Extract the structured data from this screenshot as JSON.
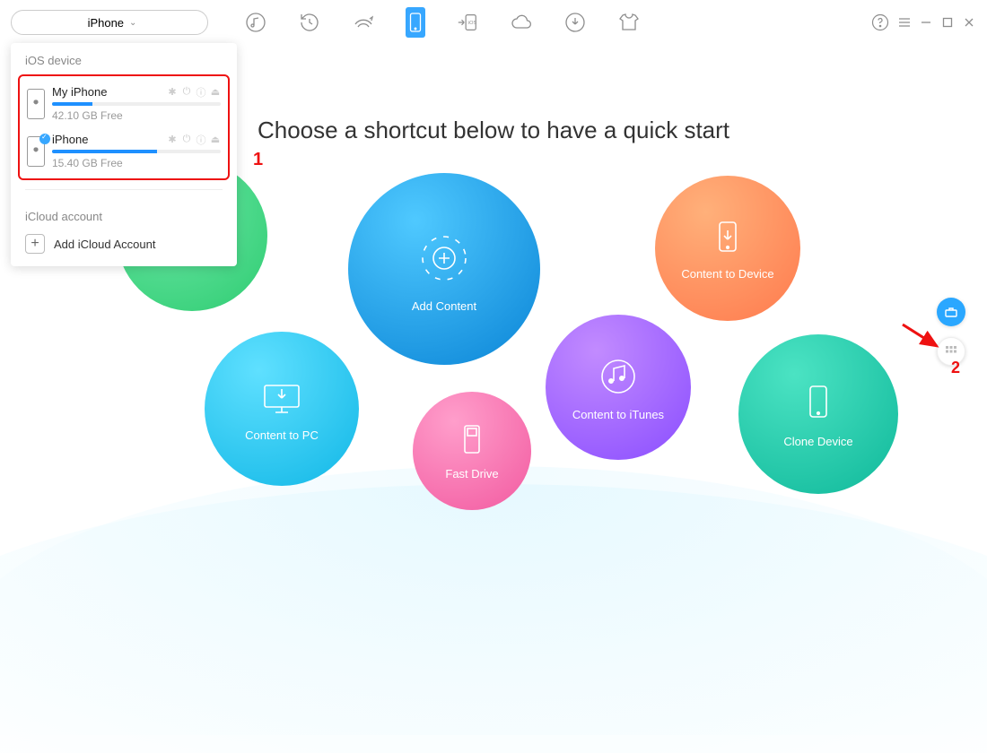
{
  "toolbar": {
    "device_selector_label": "iPhone"
  },
  "dropdown": {
    "ios_section": "iOS device",
    "devices": [
      {
        "name": "My iPhone",
        "free": "42.10 GB Free",
        "fill_pct": 24,
        "checked": false
      },
      {
        "name": "iPhone",
        "free": "15.40 GB Free",
        "fill_pct": 62,
        "checked": true
      }
    ],
    "icloud_section": "iCloud account",
    "add_icloud": "Add iCloud Account"
  },
  "heading": "Choose a shortcut below to have a quick start",
  "bubbles": {
    "add_content": "Add Content",
    "content_to_device": "Content to Device",
    "content_to_pc": "Content to PC",
    "fast_drive": "Fast Drive",
    "content_to_itunes": "Content to iTunes",
    "clone_device": "Clone Device"
  },
  "annotations": {
    "one": "1",
    "two": "2"
  }
}
